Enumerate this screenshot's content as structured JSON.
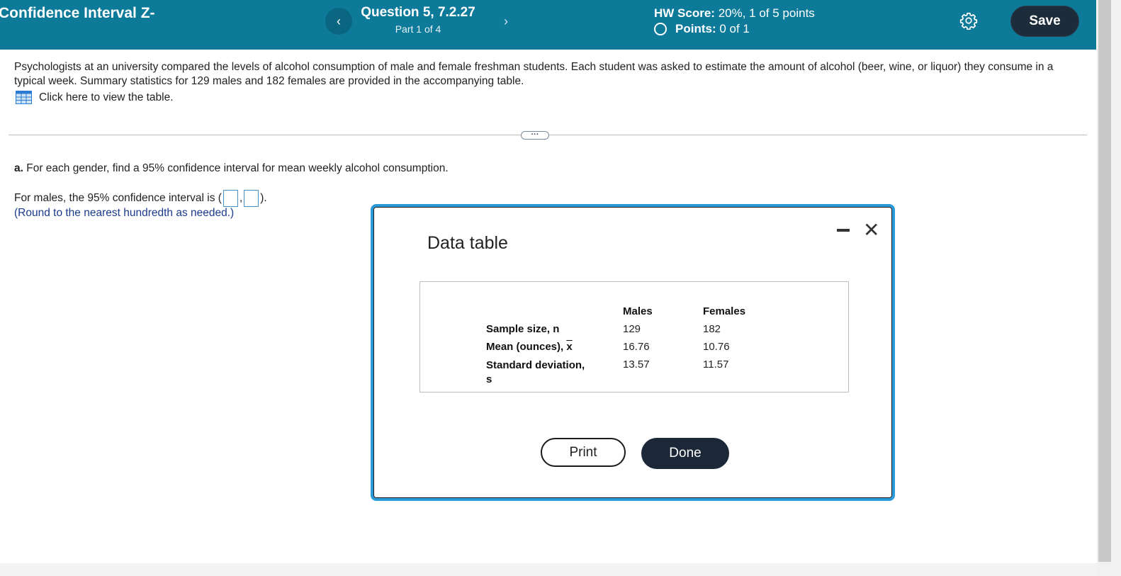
{
  "header": {
    "title": "Confidence Interval Z-",
    "question_title": "Question 5, 7.2.27",
    "question_part": "Part 1 of 4",
    "hw_score_label": "HW Score:",
    "hw_score_value": "20%, 1 of 5 points",
    "points_label": "Points:",
    "points_value": "0 of 1",
    "save_label": "Save",
    "prev_glyph": "‹",
    "next_glyph": "›",
    "bg_color": "#0d7a99"
  },
  "problem": {
    "text": "Psychologists at an university compared the levels of alcohol consumption of male and female freshman students. Each student was asked to estimate the amount of alcohol (beer, wine, or liquor) they consume in a typical week. Summary statistics for 129 males and 182 females are provided in the accompanying table.",
    "view_table_link": "Click here to view the table."
  },
  "divider_dots": "···",
  "part_a": {
    "label": "a.",
    "instruction": "For each gender, find a 95% confidence interval for mean weekly alcohol consumption.",
    "ci_prefix": "For males, the 95% confidence interval is (",
    "ci_separator": ",",
    "ci_suffix": ").",
    "hint": "(Round to the nearest hundredth as needed.)"
  },
  "modal": {
    "title": "Data table",
    "minimize_glyph": "–",
    "close_glyph": "✕",
    "columns": [
      "Males",
      "Females"
    ],
    "rows": [
      {
        "label": "Sample size, n",
        "males": "129",
        "females": "182"
      },
      {
        "label_prefix": "Mean (ounces), ",
        "label_symbol": "x",
        "males": "16.76",
        "females": "10.76"
      },
      {
        "label_line1": "Standard deviation,",
        "label_line2": "s",
        "males": "13.57",
        "females": "11.57"
      }
    ],
    "print_label": "Print",
    "done_label": "Done"
  }
}
